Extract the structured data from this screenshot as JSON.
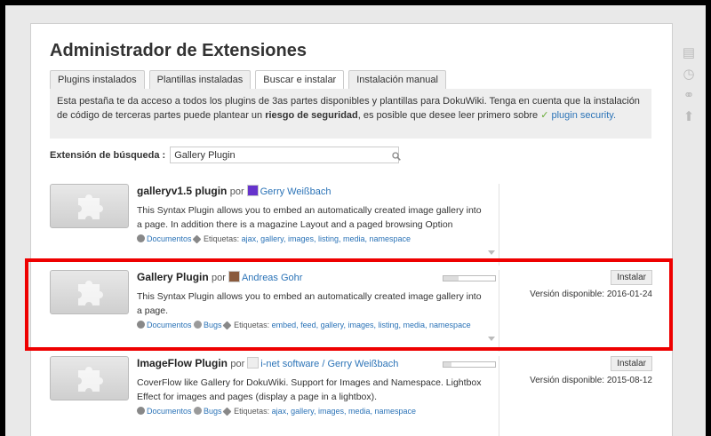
{
  "page_id": "wiki:welcome",
  "title": "Administrador de Extensiones",
  "tabs": [
    "Plugins instalados",
    "Plantillas instaladas",
    "Buscar e instalar",
    "Instalación manual"
  ],
  "info": {
    "text1": "Esta pestaña te da acceso a todos los plugins de 3as partes disponibles y plantillas para DokuWiki. Tenga en cuenta que la instalación de código de terceras partes puede plantear un ",
    "bold": "riesgo de seguridad",
    "text2": ", es posible que desee leer primero sobre ",
    "link": "plugin security."
  },
  "search": {
    "label": "Extensión de búsqueda :",
    "value": "Gallery Plugin"
  },
  "por": "por",
  "etiquetas": "Etiquetas:",
  "documentos": "Documentos",
  "bugs": "Bugs",
  "install_label": "Instalar",
  "plugins": [
    {
      "name": "galleryv1.5 plugin",
      "author": "Gerry Weißbach",
      "desc": "This Syntax Plugin allows you to embed an automatically created image gallery into a page. In addition there is a magazine Layout and a paged browsing Option",
      "tags": "ajax, gallery, images, listing, media, namespace"
    },
    {
      "name": "Gallery Plugin",
      "author": "Andreas Gohr",
      "desc": "This Syntax Plugin allows you to embed an automatically created image gallery into a page.",
      "tags": "embed, feed, gallery, images, listing, media, namespace",
      "version": "Versión disponible: 2016-01-24"
    },
    {
      "name": "ImageFlow Plugin",
      "author": "i-net software / Gerry Weißbach",
      "desc": "CoverFlow like Gallery for DokuWiki. Support for Images and Namespace. Lightbox Effect for images and pages (display a page in a lightbox).",
      "tags": "ajax, gallery, images, media, namespace",
      "version": "Versión disponible: 2015-08-12"
    }
  ],
  "colors": {
    "highlight": "#e00000",
    "link": "#2b73b7"
  }
}
